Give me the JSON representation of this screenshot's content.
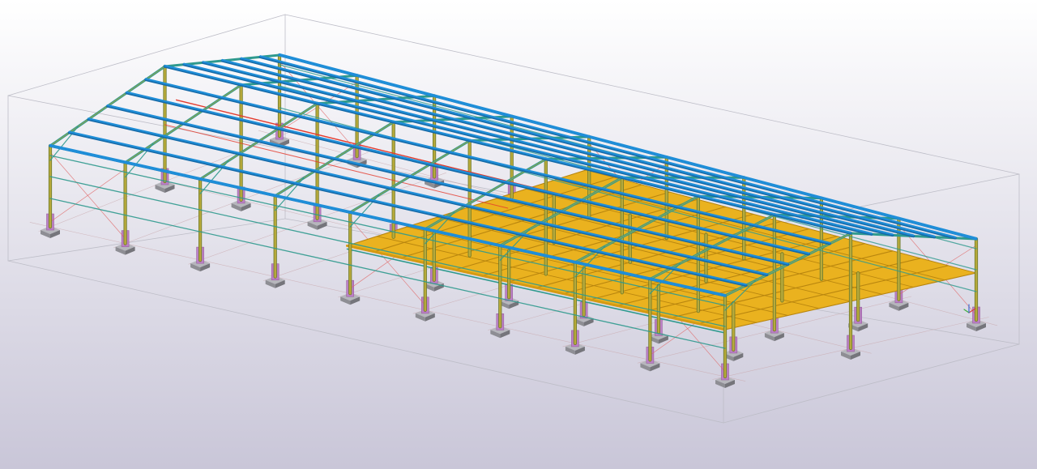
{
  "viewport": {
    "background_top": "#ffffff",
    "background_bottom": "#c9c6d8"
  },
  "colors": {
    "purlins": "#1f8ed8",
    "purlin_dark": "#156aa8",
    "frames": "#2f9a8e",
    "columns": "#b7a93a",
    "column_edge": "#6c7a2c",
    "floor_beams": "#eab21f",
    "floor_dark": "#b9860f",
    "pedestal": "#bc80c6",
    "footing": "#8e8e94",
    "footing_top": "#b6b6bc",
    "bracing": "#e06868",
    "highlight_beam": "#e43a2c",
    "work_area_box": "#bdbdc7",
    "grid_line": "#c9a8ad"
  },
  "model": {
    "main_frames": 10,
    "floor_frames": 6,
    "purlin_rows": 12,
    "view": "isometric"
  }
}
